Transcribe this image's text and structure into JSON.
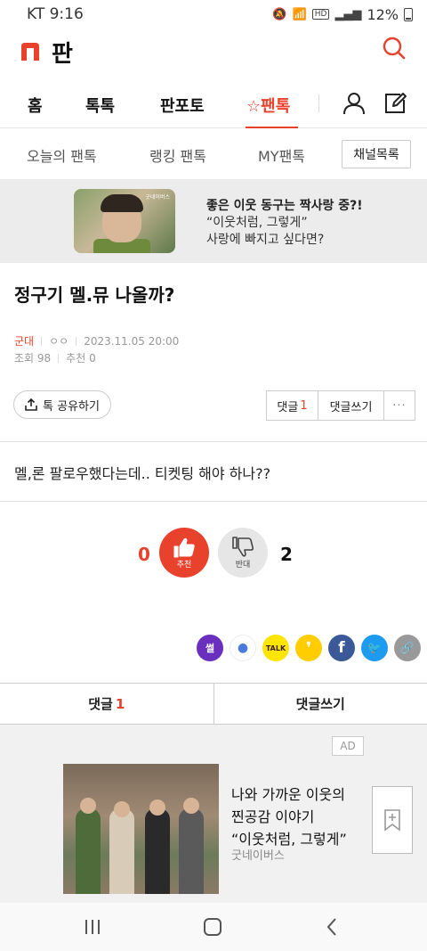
{
  "status_bar": {
    "carrier_time": "KT 9:16",
    "battery": "12%",
    "icons": [
      "mute-icon",
      "wifi-icon",
      "hd-icon",
      "signal-icon",
      "battery-icon"
    ]
  },
  "header": {
    "logo_text": "판",
    "brand_color": "#e8412c"
  },
  "gnb": {
    "items": [
      {
        "label": "홈"
      },
      {
        "label": "톡톡"
      },
      {
        "label": "판포토"
      },
      {
        "label": "팬톡",
        "active": true
      }
    ]
  },
  "subnav": {
    "items": [
      "오늘의 팬톡",
      "랭킹 팬톡",
      "MY팬톡"
    ],
    "channel_button": "채널목록"
  },
  "banner": {
    "thumb_mark": "굿네이버스",
    "line1": "좋은 이웃 동구는 짝사랑 중?!",
    "line2": "“이웃처럼, 그렇게”",
    "line3": "사랑에 빠지고 싶다면?"
  },
  "post": {
    "title": "정구기 멜.뮤 나올까?",
    "author": "군대",
    "nickname": "ㅇㅇ",
    "datetime": "2023.11.05 20:00",
    "views": "조회 98",
    "recommends": "추천 0",
    "body": "멜,론 팔로우했다는데.. 티켓팅 해야 하나??"
  },
  "actions": {
    "share_label": "톡 공유하기",
    "comment_label": "댓글",
    "comment_count": "1",
    "write_label": "댓글쓰기",
    "more_label": "···"
  },
  "vote": {
    "up_count": "0",
    "up_label": "추천",
    "down_count": "2",
    "down_label": "반대"
  },
  "sns": {
    "items": [
      {
        "name": "ssul",
        "label": "썰",
        "color": "#6b2fbf"
      },
      {
        "name": "band",
        "label": "●",
        "color": "#ffffff"
      },
      {
        "name": "kakaotalk",
        "label": "TALK",
        "color": "#fee500"
      },
      {
        "name": "kakaostory",
        "label": "❜",
        "color": "#ffcd00"
      },
      {
        "name": "facebook",
        "label": "f",
        "color": "#3b5998"
      },
      {
        "name": "twitter",
        "label": "🐦",
        "color": "#1d9bf0"
      },
      {
        "name": "link",
        "label": "🔗",
        "color": "#999999"
      }
    ]
  },
  "tabs": {
    "comment_label": "댓글",
    "comment_count": "1",
    "write_label": "댓글쓰기"
  },
  "ad": {
    "badge": "AD",
    "line1": "나와 가까운 이웃의",
    "line2": "찐공감 이야기",
    "line3": "“이웃처럼, 그렇게”",
    "source": "굿네이버스"
  }
}
